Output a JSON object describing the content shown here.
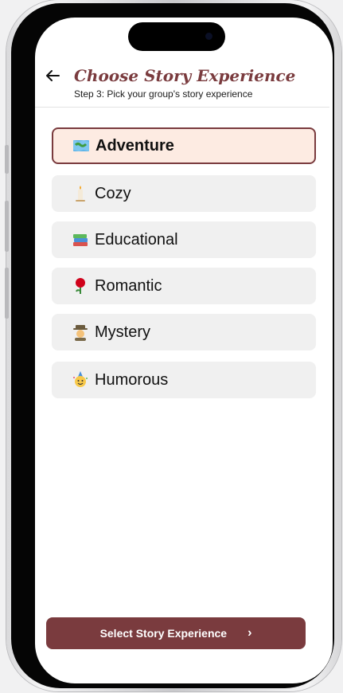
{
  "header": {
    "title": "Choose Story Experience",
    "subtitle": "Step 3: Pick your group's story experience"
  },
  "options": [
    {
      "label": "Adventure",
      "icon": "map-icon",
      "selected": true
    },
    {
      "label": "Cozy",
      "icon": "candle-icon",
      "selected": false
    },
    {
      "label": "Educational",
      "icon": "books-icon",
      "selected": false
    },
    {
      "label": "Romantic",
      "icon": "rose-icon",
      "selected": false
    },
    {
      "label": "Mystery",
      "icon": "detective-icon",
      "selected": false
    },
    {
      "label": "Humorous",
      "icon": "party-face-icon",
      "selected": false
    }
  ],
  "cta": {
    "label": "Select Story Experience",
    "chevron": "›"
  },
  "colors": {
    "accent": "#7a3b3e",
    "selected_bg": "#fdebe2",
    "option_bg": "#f0f0f0"
  }
}
